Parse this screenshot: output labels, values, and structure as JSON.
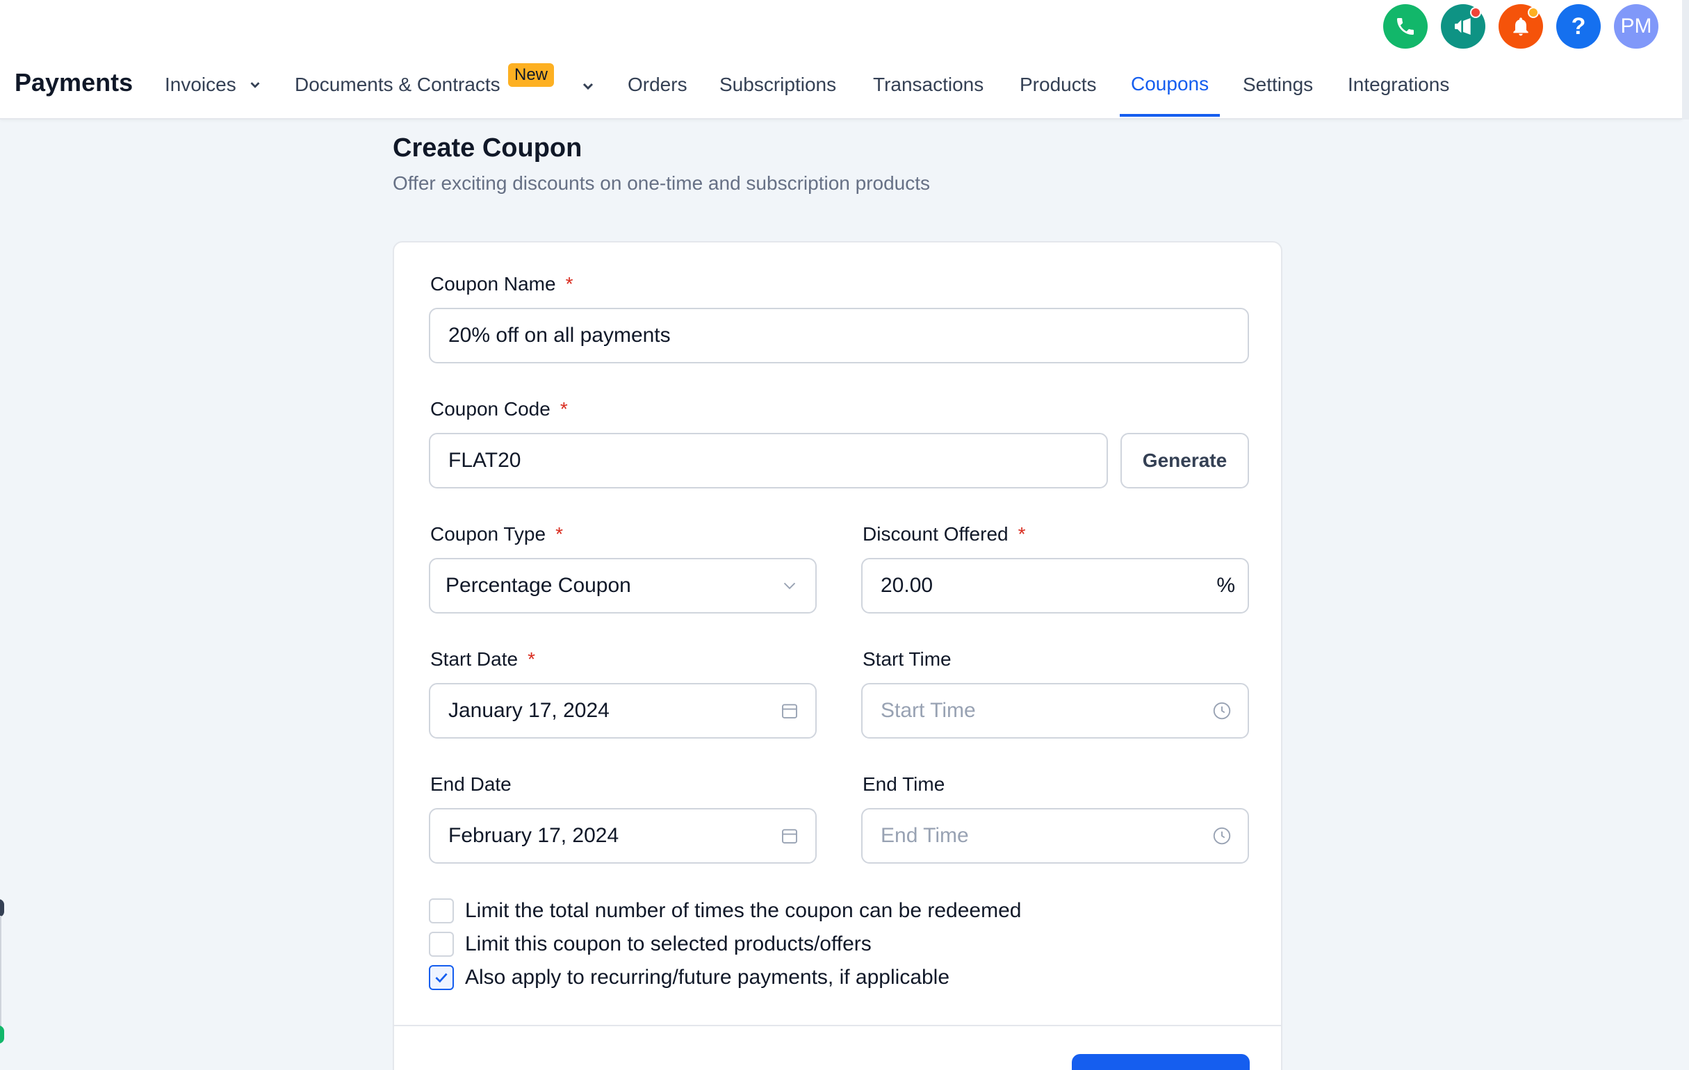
{
  "header": {
    "brand": "Payments",
    "nav": [
      {
        "label": "Invoices"
      },
      {
        "label": "Documents & Contracts",
        "badge": "New"
      },
      {
        "label": "Orders"
      },
      {
        "label": "Subscriptions"
      },
      {
        "label": "Transactions"
      },
      {
        "label": "Products"
      },
      {
        "label": "Coupons",
        "active": true
      },
      {
        "label": "Settings"
      },
      {
        "label": "Integrations"
      }
    ],
    "icons": [
      {
        "name": "phone-icon",
        "color": "#12b76a"
      },
      {
        "name": "megaphone-icon",
        "color": "#0e9384"
      },
      {
        "name": "bell-icon",
        "color": "#f04438"
      },
      {
        "name": "help-icon",
        "color": "#1570ef"
      },
      {
        "name": "avatar",
        "color": "#8098f9"
      }
    ],
    "avatar_initials": "PM"
  },
  "page": {
    "title": "Create Coupon",
    "subtitle": "Offer exciting discounts on one-time and subscription products"
  },
  "form": {
    "coupon_name": {
      "label": "Coupon Name",
      "required": "*",
      "value": "20% off on all payments"
    },
    "coupon_code": {
      "label": "Coupon Code",
      "required": "*",
      "value": "FLAT20",
      "button": "Generate"
    },
    "coupon_type": {
      "label": "Coupon Type",
      "required": "*",
      "value": "Percentage Coupon"
    },
    "discount": {
      "label": "Discount Offered",
      "required": "*",
      "value": "20.00",
      "suffix": "%"
    },
    "start_date": {
      "label": "Start Date",
      "required": "*",
      "value": "January 17, 2024"
    },
    "start_time": {
      "label": "Start Time",
      "placeholder": "Start Time"
    },
    "end_date": {
      "label": "End Date",
      "value": "February 17, 2024"
    },
    "end_time": {
      "label": "End Time",
      "placeholder": "End Time"
    },
    "checkboxes": [
      {
        "label": "Limit the total number of times the coupon can be redeemed",
        "checked": false
      },
      {
        "label": "Limit this coupon to selected products/offers",
        "checked": false
      },
      {
        "label": "Also apply to recurring/future payments, if applicable",
        "checked": true
      }
    ]
  },
  "colors": {
    "accent": "#155eef",
    "required": "#d92d20",
    "badge": "#fdb022"
  }
}
